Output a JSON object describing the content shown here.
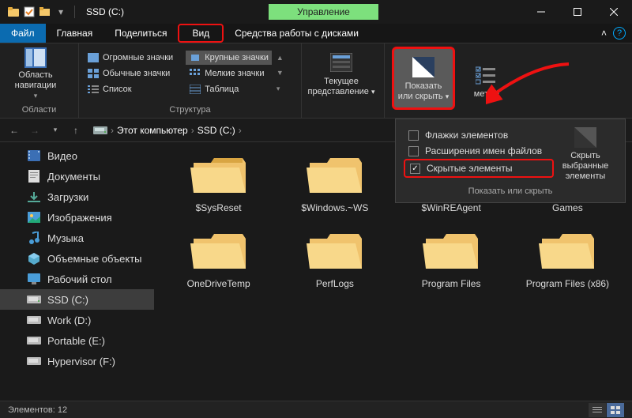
{
  "titlebar": {
    "title": "SSD (C:)",
    "contextual_tab": "Управление",
    "min": "—",
    "max": "☐",
    "close": "✕"
  },
  "menu": {
    "file": "Файл",
    "home": "Главная",
    "share": "Поделиться",
    "view": "Вид",
    "drive_tools": "Средства работы с дисками"
  },
  "ribbon": {
    "nav_pane": "Область навигации",
    "areas": "Области",
    "huge_icons": "Огромные значки",
    "large_icons": "Крупные значки",
    "medium_icons": "Обычные значки",
    "small_icons": "Мелкие значки",
    "list": "Список",
    "table": "Таблица",
    "structure": "Структура",
    "current_view_1": "Текущее",
    "current_view_2": "представление",
    "show_hide_1": "Показать",
    "show_hide_2": "или скрыть",
    "options": "метры"
  },
  "dropdown": {
    "item1": "Флажки элементов",
    "item2": "Расширения имен файлов",
    "item3": "Скрытые элементы",
    "hide_sel_1": "Скрыть выбранные",
    "hide_sel_2": "элементы",
    "footer": "Показать или скрыть"
  },
  "breadcrumb": {
    "this_pc": "Этот компьютер",
    "drive": "SSD (C:)"
  },
  "sidebar": {
    "items": [
      {
        "label": "Видео"
      },
      {
        "label": "Документы"
      },
      {
        "label": "Загрузки"
      },
      {
        "label": "Изображения"
      },
      {
        "label": "Музыка"
      },
      {
        "label": "Объемные объекты"
      },
      {
        "label": "Рабочий стол"
      },
      {
        "label": "SSD (C:)"
      },
      {
        "label": "Work (D:)"
      },
      {
        "label": "Portable (E:)"
      },
      {
        "label": "Hypervisor (F:)"
      }
    ]
  },
  "folders": [
    "$SysReset",
    "$Windows.~WS",
    "$WinREAgent",
    "Games",
    "OneDriveTemp",
    "PerfLogs",
    "Program Files",
    "Program Files (x86)"
  ],
  "statusbar": {
    "count": "Элементов: 12"
  }
}
